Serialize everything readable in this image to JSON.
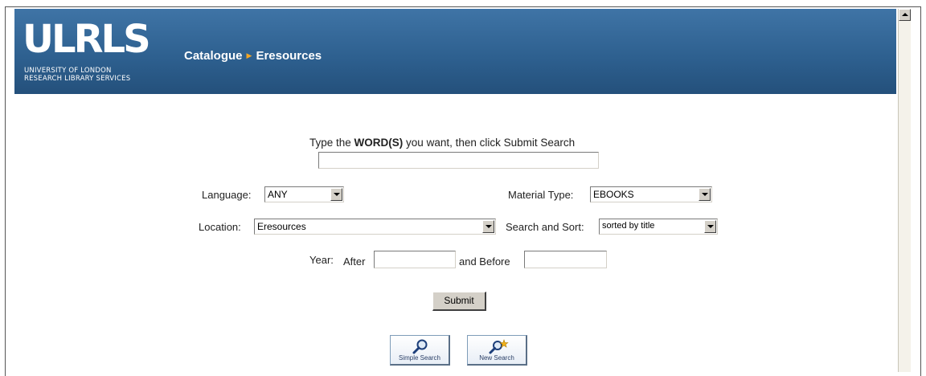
{
  "header": {
    "logo_mark": "ULRLS",
    "logo_line1": "UNIVERSITY OF LONDON",
    "logo_line2": "RESEARCH LIBRARY SERVICES",
    "breadcrumb": [
      "Catalogue",
      "Eresources"
    ]
  },
  "search": {
    "prompt_before": "Type the ",
    "prompt_bold": "WORD(S)",
    "prompt_after": " you want, then click Submit Search",
    "query_value": ""
  },
  "filters": {
    "language_label": "Language:",
    "language_value": "ANY",
    "material_label": "Material Type:",
    "material_value": "EBOOKS",
    "location_label": "Location:",
    "location_value": "Eresources",
    "sort_label": "Search and Sort:",
    "sort_value": "sorted by title",
    "year_label": "Year:",
    "after_label": "After",
    "after_value": "",
    "before_label": "and Before",
    "before_value": ""
  },
  "buttons": {
    "submit_label": "Submit",
    "simple_search_label": "Simple Search",
    "new_search_label": "New Search"
  },
  "icons": {
    "simple_search": "magnifier-icon",
    "new_search": "magnifier-sparkle-icon"
  },
  "colors": {
    "banner": "#2d5f8e",
    "breadcrumb_separator": "#f5a623"
  }
}
